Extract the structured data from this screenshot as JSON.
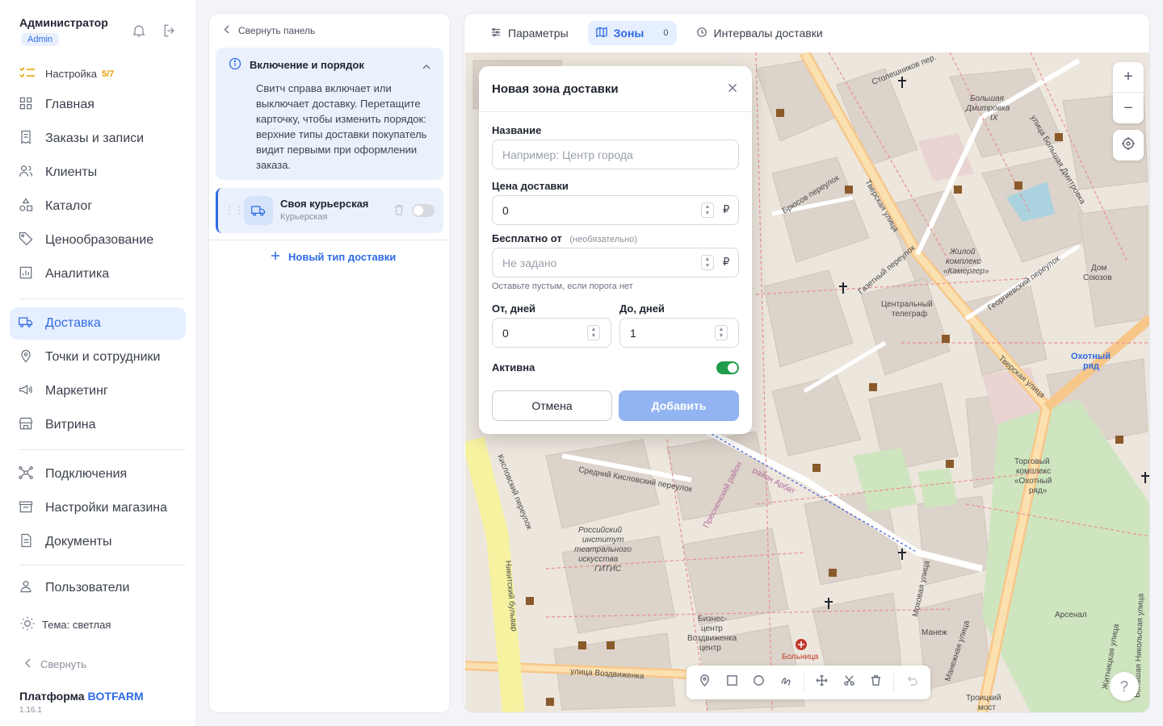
{
  "user": {
    "name": "Администратор",
    "role": "Admin"
  },
  "setup": {
    "label": "Настройка",
    "progress": "5/7"
  },
  "nav_main": [
    {
      "label": "Главная",
      "icon": "grid-icon"
    },
    {
      "label": "Заказы и записи",
      "icon": "receipt-icon"
    },
    {
      "label": "Клиенты",
      "icon": "users-icon"
    },
    {
      "label": "Каталог",
      "icon": "shapes-icon"
    },
    {
      "label": "Ценообразование",
      "icon": "tag-icon"
    },
    {
      "label": "Аналитика",
      "icon": "chart-icon"
    }
  ],
  "nav_delivery": [
    {
      "label": "Доставка",
      "icon": "truck-icon",
      "active": true
    },
    {
      "label": "Точки и сотрудники",
      "icon": "pin-icon"
    },
    {
      "label": "Маркетинг",
      "icon": "megaphone-icon"
    },
    {
      "label": "Витрина",
      "icon": "storefront-icon"
    }
  ],
  "nav_settings": [
    {
      "label": "Подключения",
      "icon": "network-icon"
    },
    {
      "label": "Настройки магазина",
      "icon": "shop-icon"
    },
    {
      "label": "Документы",
      "icon": "document-icon"
    }
  ],
  "nav_users": [
    {
      "label": "Пользователи",
      "icon": "user-icon"
    }
  ],
  "theme_label": "Тема: светлая",
  "collapse_label": "Свернуть",
  "platform": {
    "prefix": "Платформа",
    "brand": "BOTFARM",
    "version": "1.16.1"
  },
  "panel": {
    "collapse_label": "Свернуть панель",
    "info_title": "Включение и порядок",
    "info_text": "Свитч справа включает или выключает доставку. Перетащите карточку, чтобы изменить порядок: верхние типы доставки покупатель видит первыми при оформлении заказа.",
    "delivery_type": {
      "title": "Своя курьерская",
      "subtitle": "Курьерская",
      "enabled": false
    },
    "new_type_label": "Новый тип доставки"
  },
  "tabs": [
    {
      "label": "Параметры",
      "icon": "sliders-icon",
      "active": false
    },
    {
      "label": "Зоны",
      "icon": "map-icon",
      "active": true,
      "count": "0"
    },
    {
      "label": "Интервалы доставки",
      "icon": "clock-icon",
      "active": false
    }
  ],
  "map_labels": [
    "Столешников пер.",
    "Тверская улица",
    "Брюсов переулок",
    "Газетный переулок",
    "Центральный телеграф",
    "Георгиевский переулок",
    "Дом Союзов",
    "Охотный ряд",
    "Жилой комплекс «Камергер»",
    "Большая Дмитровка IX",
    "улица Большая Дмитровка",
    "Средний Кисловский переулок",
    "Российский институт театрального искусства ГИТИС",
    "Никитский бульвар",
    "улица Воздвиженка",
    "Бизнес-центр Воздвиженка центр",
    "Больница",
    "Моховая улица",
    "Манеж",
    "Манежная улица",
    "Арсенал",
    "Торговый комплекс «Охотный ряд»",
    "Троицкий мост",
    "Пресненский район",
    "район Арбат",
    "Кисловский переулок",
    "Большая Никольская улица",
    "Житницкая улица"
  ],
  "modal": {
    "title": "Новая зона доставки",
    "name_label": "Название",
    "name_placeholder": "Например: Центр города",
    "price_label": "Цена доставки",
    "price_value": "0",
    "currency": "₽",
    "free_label": "Бесплатно от",
    "free_optional": "(необязательно)",
    "free_placeholder": "Не задано",
    "free_hint": "Оставьте пустым, если порога нет",
    "from_label": "От, дней",
    "from_value": "0",
    "to_label": "До, дней",
    "to_value": "1",
    "active_label": "Активна",
    "active": true,
    "cancel_label": "Отмена",
    "add_label": "Добавить"
  },
  "colors": {
    "accent": "#2f6be5",
    "active_bg": "#e6efff",
    "toggle_on": "#1f9d4a",
    "add_disabled": "#93b4f2",
    "setup_progress": "#e5a100"
  }
}
